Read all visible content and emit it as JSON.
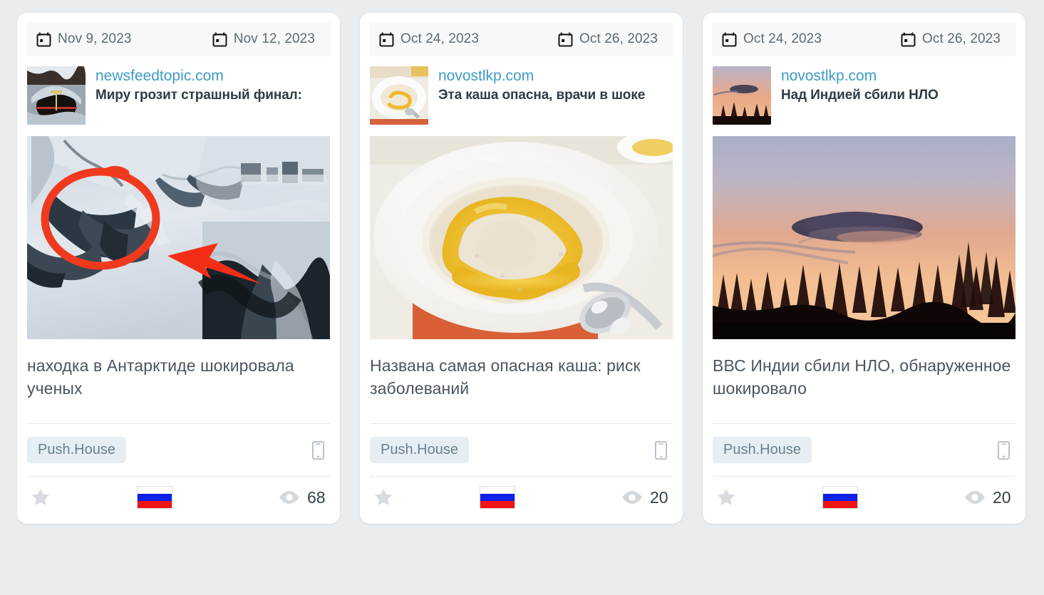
{
  "page": {
    "background_color": "#e9edf0",
    "card_background": "#ffffff",
    "accent_link_color": "#3e9bc4",
    "badge_background": "#e7eef3",
    "badge_text_color": "#69808f"
  },
  "cards": [
    {
      "start_date": "Nov 9, 2023",
      "end_date": "Nov 12, 2023",
      "domain": "newsfeedtopic.com",
      "push_title": "Миру грозит страшный финал:",
      "body_text": "находка в Антарктиде шокировала ученых",
      "network": "Push.House",
      "device": "mobile",
      "country_flag": "ru",
      "views": "68",
      "starred": false,
      "thumbnail": "antarctica-ice-cave",
      "hero_image": "antarctica-snow-red-circle-arrow"
    },
    {
      "start_date": "Oct 24, 2023",
      "end_date": "Oct 26, 2023",
      "domain": "novostlkp.com",
      "push_title": "Эта каша опасна, врачи в шоке",
      "body_text": "Названа самая опасная каша: риск заболеваний",
      "network": "Push.House",
      "device": "mobile",
      "country_flag": "ru",
      "views": "20",
      "starred": false,
      "thumbnail": "porridge-bowl",
      "hero_image": "porridge-plate-with-honey-and-spoon"
    },
    {
      "start_date": "Oct 24, 2023",
      "end_date": "Oct 26, 2023",
      "domain": "novostlkp.com",
      "push_title": "Над Индией сбили НЛО",
      "body_text": "ВВС Индии сбили НЛО, обнаруженное шокировало",
      "network": "Push.House",
      "device": "mobile",
      "country_flag": "ru",
      "views": "20",
      "starred": false,
      "thumbnail": "ufo-sunset-trees",
      "hero_image": "ufo-lenticular-cloud-over-sunset-treeline"
    }
  ],
  "icons": {
    "calendar": "calendar-icon",
    "star": "star-icon",
    "eye": "eye-icon",
    "device": "mobile-phone-icon",
    "flag": "russia-flag-icon"
  }
}
